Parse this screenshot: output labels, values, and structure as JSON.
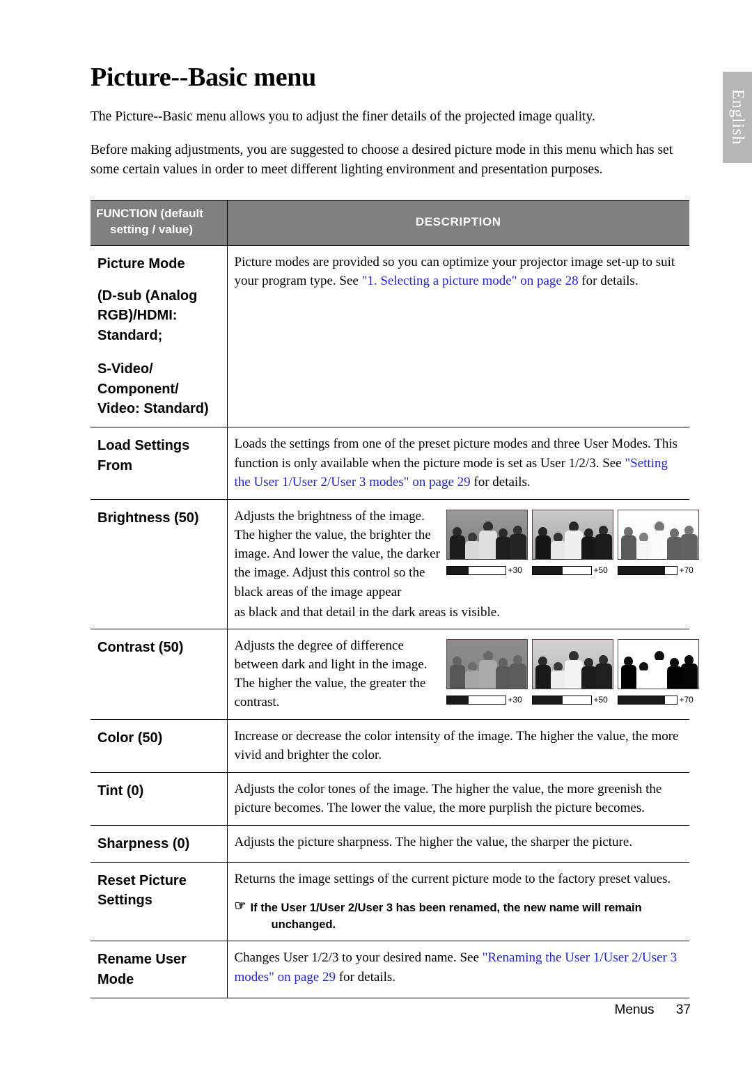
{
  "language_tab": "English",
  "page_title": "Picture--Basic menu",
  "intro": [
    "The Picture--Basic menu allows you to adjust the finer details of the projected image quality.",
    "Before making adjustments, you are suggested to choose a desired picture mode in this menu which has set some certain values in order to meet different lighting environment and presentation purposes."
  ],
  "table": {
    "header": {
      "function_line1": "FUNCTION (default",
      "function_line2": "setting / value)",
      "description": "DESCRIPTION"
    },
    "rows": [
      {
        "function": "Picture Mode",
        "function_sub": [
          "(D-sub (Analog",
          "RGB)/HDMI:",
          "Standard;",
          "S-Video/",
          "Component/",
          "Video: Standard)"
        ],
        "description_pre": "Picture modes are provided so you can optimize your projector image set-up to suit your program type. See ",
        "description_link": "\"1. Selecting a picture mode\" on page 28",
        "description_post": " for details."
      },
      {
        "function": "Load Settings From",
        "description_pre": "Loads the settings from one of the preset picture modes and three User Modes. This function is only available when the picture mode is set as User 1/2/3. See ",
        "description_link": "\"Setting the User 1/User 2/User 3 modes\" on page 29",
        "description_post": " for details."
      },
      {
        "function": "Brightness (50)",
        "description": "Adjusts the brightness of the image. The higher the value, the brighter the image. And lower the value, the darker the image. Adjust this control so the black areas of the image appear",
        "description_tail": "as black and that detail in the dark areas is visible.",
        "samples": [
          {
            "value": "+30",
            "fill_pct": 38
          },
          {
            "value": "+50",
            "fill_pct": 52
          },
          {
            "value": "+70",
            "fill_pct": 80
          }
        ]
      },
      {
        "function": "Contrast (50)",
        "description": "Adjusts the degree of difference between dark and light in the image. The higher the value, the greater the contrast.",
        "samples": [
          {
            "value": "+30",
            "fill_pct": 38
          },
          {
            "value": "+50",
            "fill_pct": 52
          },
          {
            "value": "+70",
            "fill_pct": 80
          }
        ]
      },
      {
        "function": "Color (50)",
        "description": "Increase or decrease the color intensity of the image. The higher the value, the more vivid and brighter the color."
      },
      {
        "function": "Tint (0)",
        "description": "Adjusts the color tones of the image. The higher the value, the more greenish the picture becomes. The lower the value, the more purplish the picture becomes."
      },
      {
        "function": "Sharpness (0)",
        "description": "Adjusts the picture sharpness. The higher the value, the sharper the picture."
      },
      {
        "function": "Reset Picture Settings",
        "description": "Returns the image settings of the current picture mode to the factory preset values.",
        "note_icon": "☞",
        "note_line1": "If the User 1/User 2/User 3 has been renamed, the new name will remain",
        "note_line2": "unchanged."
      },
      {
        "function": "Rename User Mode",
        "description_pre": "Changes User 1/2/3 to your desired name. See ",
        "description_link": "\"Renaming the User 1/User 2/User 3 modes\" on page 29",
        "description_post": " for details."
      }
    ]
  },
  "footer": {
    "label": "Menus",
    "page_number": "37"
  },
  "colors": {
    "header_bg": "#808080",
    "link": "#2525cc",
    "tab_bg": "#b6b6b6"
  }
}
